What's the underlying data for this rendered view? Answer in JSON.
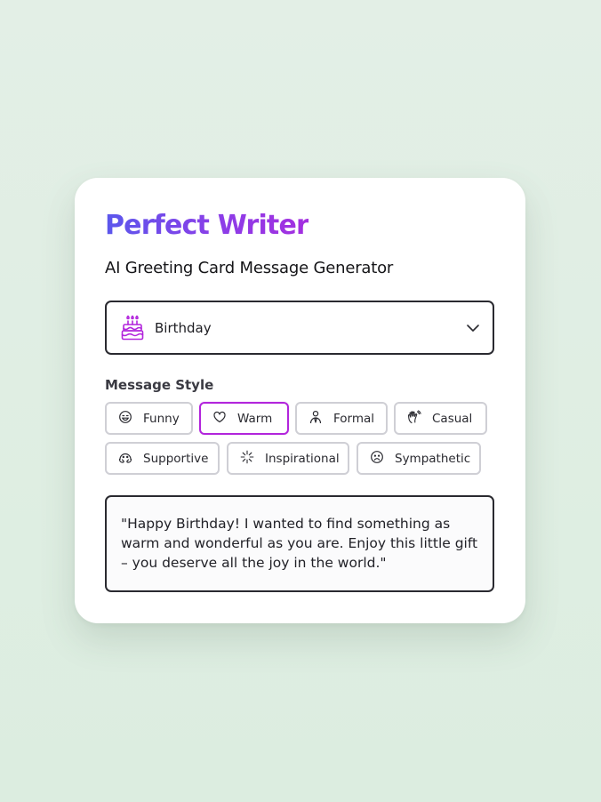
{
  "brand": {
    "title": "Perfect Writer",
    "subtitle": "AI Greeting Card Message Generator"
  },
  "occasion": {
    "icon": "birthday-cake-icon",
    "selected": "Birthday"
  },
  "style": {
    "label": "Message Style",
    "selected": "Warm",
    "chips": [
      {
        "label": "Funny",
        "icon": "smile-icon"
      },
      {
        "label": "Warm",
        "icon": "heart-icon"
      },
      {
        "label": "Formal",
        "icon": "person-tie-icon"
      },
      {
        "label": "Casual",
        "icon": "waving-hand-icon"
      },
      {
        "label": "Supportive",
        "icon": "supportive-face-icon"
      },
      {
        "label": "Inspirational",
        "icon": "sparkle-icon"
      },
      {
        "label": "Sympathetic",
        "icon": "sad-face-icon"
      }
    ]
  },
  "message": {
    "text": "\"Happy Birthday! I wanted to find something as warm and wonderful as you are. Enjoy this little gift – you deserve all the joy in the world.\""
  },
  "colors": {
    "accent": "#b225dc",
    "brand_start": "#5b57ec",
    "brand_end": "#a42fe0",
    "background": "#e3efe6"
  }
}
